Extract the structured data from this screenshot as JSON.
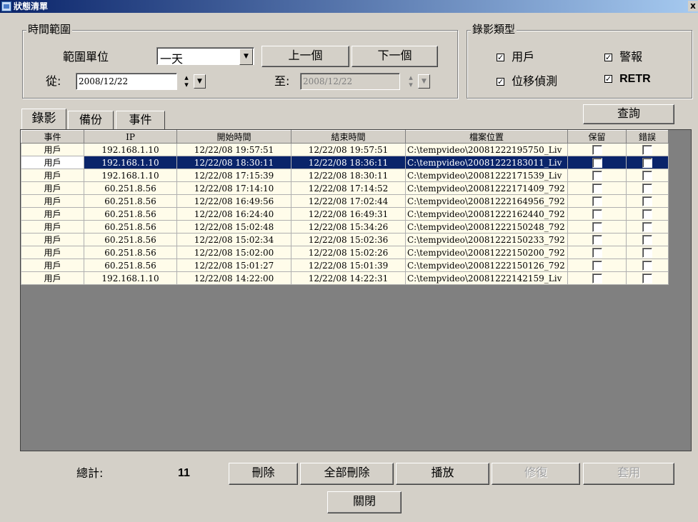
{
  "window": {
    "title": "狀態清單",
    "close": "x"
  },
  "time_range": {
    "legend": "時間範圍",
    "unit_label": "範圍單位",
    "unit_value": "一天",
    "prev_button": "上一個",
    "next_button": "下一個",
    "from_label": "從:",
    "from_value": "2008/12/22",
    "to_label": "至:",
    "to_value": "2008/12/22"
  },
  "record_type": {
    "legend": "錄影類型",
    "options": [
      {
        "label": "用戶",
        "checked": true
      },
      {
        "label": "警報",
        "checked": true
      },
      {
        "label": "位移偵測",
        "checked": true
      },
      {
        "label": "RETR",
        "checked": true
      }
    ]
  },
  "tabs": [
    "錄影",
    "備份",
    "事件"
  ],
  "query_button": "查詢",
  "table": {
    "columns": [
      "事件",
      "IP",
      "開始時間",
      "結束時間",
      "檔案位置",
      "保留",
      "錯誤"
    ],
    "rows": [
      {
        "event": "用戶",
        "ip": "192.168.1.10",
        "start": "12/22/08 19:57:51",
        "end": "12/22/08 19:57:51",
        "path": "C:\\tempvideo\\20081222195750_Liv",
        "selected": false
      },
      {
        "event": "用戶",
        "ip": "192.168.1.10",
        "start": "12/22/08 18:30:11",
        "end": "12/22/08 18:36:11",
        "path": "C:\\tempvideo\\20081222183011_Liv",
        "selected": true
      },
      {
        "event": "用戶",
        "ip": "192.168.1.10",
        "start": "12/22/08 17:15:39",
        "end": "12/22/08 18:30:11",
        "path": "C:\\tempvideo\\20081222171539_Liv",
        "selected": false
      },
      {
        "event": "用戶",
        "ip": "60.251.8.56",
        "start": "12/22/08 17:14:10",
        "end": "12/22/08 17:14:52",
        "path": "C:\\tempvideo\\20081222171409_792",
        "selected": false
      },
      {
        "event": "用戶",
        "ip": "60.251.8.56",
        "start": "12/22/08 16:49:56",
        "end": "12/22/08 17:02:44",
        "path": "C:\\tempvideo\\20081222164956_792",
        "selected": false
      },
      {
        "event": "用戶",
        "ip": "60.251.8.56",
        "start": "12/22/08 16:24:40",
        "end": "12/22/08 16:49:31",
        "path": "C:\\tempvideo\\20081222162440_792",
        "selected": false
      },
      {
        "event": "用戶",
        "ip": "60.251.8.56",
        "start": "12/22/08 15:02:48",
        "end": "12/22/08 15:34:26",
        "path": "C:\\tempvideo\\20081222150248_792",
        "selected": false
      },
      {
        "event": "用戶",
        "ip": "60.251.8.56",
        "start": "12/22/08 15:02:34",
        "end": "12/22/08 15:02:36",
        "path": "C:\\tempvideo\\20081222150233_792",
        "selected": false
      },
      {
        "event": "用戶",
        "ip": "60.251.8.56",
        "start": "12/22/08 15:02:00",
        "end": "12/22/08 15:02:26",
        "path": "C:\\tempvideo\\20081222150200_792",
        "selected": false
      },
      {
        "event": "用戶",
        "ip": "60.251.8.56",
        "start": "12/22/08 15:01:27",
        "end": "12/22/08 15:01:39",
        "path": "C:\\tempvideo\\20081222150126_792",
        "selected": false
      },
      {
        "event": "用戶",
        "ip": "192.168.1.10",
        "start": "12/22/08 14:22:00",
        "end": "12/22/08 14:22:31",
        "path": "C:\\tempvideo\\20081222142159_Liv",
        "selected": false
      }
    ]
  },
  "footer": {
    "total_label": "總計:",
    "total_value": "11",
    "delete_button": "刪除",
    "delete_all_button": "全部刪除",
    "play_button": "播放",
    "repair_button": "修復",
    "apply_button": "套用",
    "close_button": "關閉"
  }
}
